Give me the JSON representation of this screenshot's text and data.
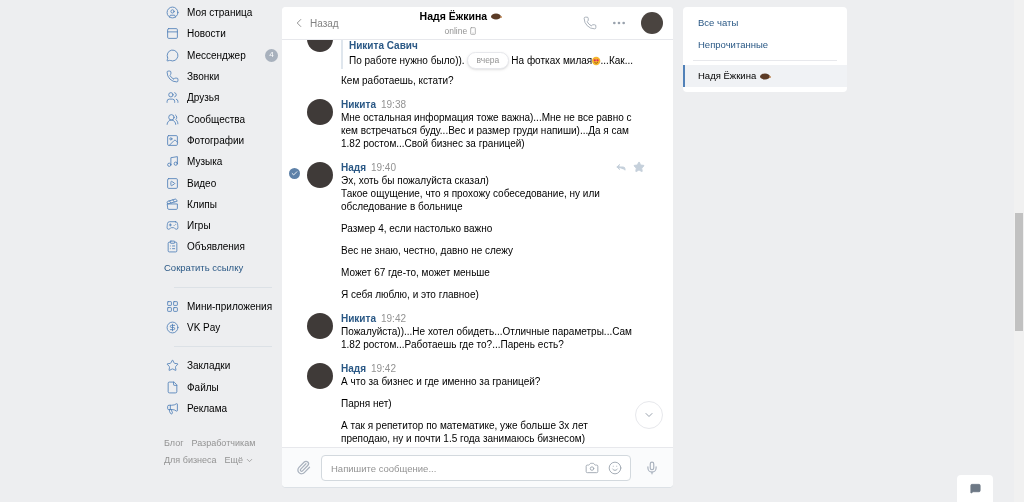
{
  "sidebar": {
    "sections": [
      {
        "items": [
          {
            "label": "Моя страница"
          },
          {
            "label": "Новости"
          },
          {
            "label": "Мессенджер",
            "badge": "4"
          },
          {
            "label": "Звонки"
          },
          {
            "label": "Друзья"
          },
          {
            "label": "Сообщества"
          },
          {
            "label": "Фотографии"
          },
          {
            "label": "Музыка"
          },
          {
            "label": "Видео"
          },
          {
            "label": "Клипы"
          },
          {
            "label": "Игры"
          },
          {
            "label": "Объявления"
          }
        ],
        "link": "Сократить ссылку"
      },
      {
        "items": [
          {
            "label": "Мини-приложения"
          },
          {
            "label": "VK Pay"
          }
        ]
      },
      {
        "items": [
          {
            "label": "Закладки"
          },
          {
            "label": "Файлы"
          },
          {
            "label": "Реклама"
          }
        ]
      }
    ],
    "footer": [
      [
        "Блог",
        "Разработчикам"
      ],
      [
        "Для бизнеса",
        "Ещё"
      ]
    ]
  },
  "chat": {
    "back": "Назад",
    "title": "Надя Ёжкина",
    "status": "online",
    "date_pill": "вчера",
    "messages": [
      {
        "selected": false,
        "quote": {
          "name": "Никита Савич",
          "text_before": "По работе нужно было)).",
          "text_after": "На фотках милая",
          "text_end": "...Как..."
        },
        "paragraphs": [
          "Кем работаешь, кстати?"
        ]
      },
      {
        "name": "Никита",
        "time": "19:38",
        "selected": false,
        "paragraphs": [
          "Мне остальная информация тоже важна)...Мне не все равно с кем встречаться буду...Вес и размер груди напиши)...Да я сам 1.82 ростом...Свой бизнес за границей)"
        ]
      },
      {
        "name": "Надя",
        "time": "19:40",
        "selected": true,
        "paragraphs": [
          "Эх, хоть бы пожалуйста сказал)\nТакое ощущение, что я прохожу собеседование, ну или обследование в больнице",
          "Размер 4, если настолько важно",
          "Вес не знаю, честно, давно не слежу",
          "Может 67 где-то, может меньше",
          "Я себя люблю, и это главное)"
        ]
      },
      {
        "name": "Никита",
        "time": "19:42",
        "selected": false,
        "paragraphs": [
          "Пожалуйста))...Не хотел обидеть...Отличные параметры...Сам 1.82 ростом...Работаешь где то?...Парень есть?"
        ]
      },
      {
        "name": "Надя",
        "time": "19:42",
        "selected": false,
        "paragraphs": [
          "А что за бизнес и где именно за границей?",
          "Парня нет)",
          "А так я репетитор по математике, уже больше 3х лет преподаю, ну и почти 1.5 года занимаюсь бизнесом)"
        ]
      }
    ],
    "composer": {
      "placeholder": "Напишите сообщение..."
    }
  },
  "right_panel": {
    "filters": [
      "Все чаты",
      "Непрочитанные"
    ],
    "chats": [
      {
        "name": "Надя Ёжкина",
        "selected": true
      }
    ]
  }
}
